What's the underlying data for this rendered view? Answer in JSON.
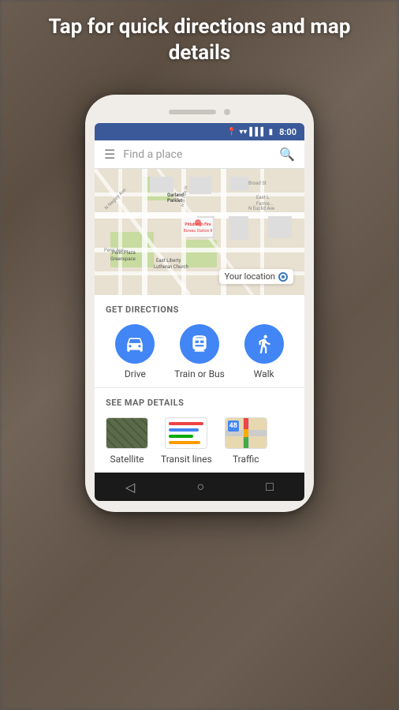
{
  "header": {
    "title": "Tap for quick directions\nand map details"
  },
  "status_bar": {
    "time": "8:00",
    "icons": [
      "location",
      "wifi",
      "signal",
      "battery"
    ]
  },
  "search": {
    "placeholder": "Find a place"
  },
  "map": {
    "your_location_label": "Your location"
  },
  "directions": {
    "section_title": "GET DIRECTIONS",
    "buttons": [
      {
        "id": "drive",
        "label": "Drive",
        "icon": "🚗"
      },
      {
        "id": "transit",
        "label": "Train or Bus",
        "icon": "🚌"
      },
      {
        "id": "walk",
        "label": "Walk",
        "icon": "🚶"
      }
    ]
  },
  "map_details": {
    "section_title": "SEE MAP DETAILS",
    "buttons": [
      {
        "id": "satellite",
        "label": "Satellite"
      },
      {
        "id": "transit",
        "label": "Transit lines"
      },
      {
        "id": "traffic",
        "label": "Traffic"
      }
    ]
  },
  "bottom_nav": {
    "back": "◁",
    "home": "○",
    "recent": "□"
  }
}
